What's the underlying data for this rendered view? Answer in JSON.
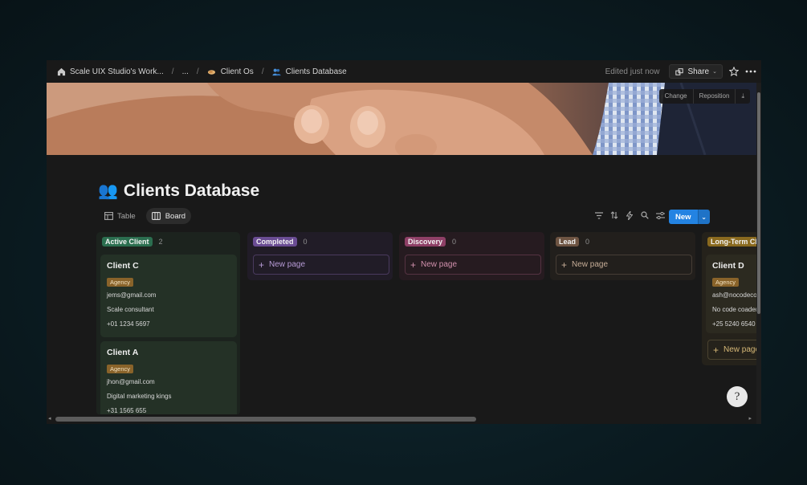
{
  "topbar": {
    "breadcrumbs": [
      {
        "icon": "home-icon",
        "label": "Scale UIX Studio's Work..."
      },
      {
        "icon": "",
        "label": "..."
      },
      {
        "icon": "handshake-icon",
        "label": "Client Os"
      },
      {
        "icon": "people-icon",
        "label": "Clients Database"
      }
    ],
    "edited": "Edited just now",
    "share_label": "Share"
  },
  "cover": {
    "change_label": "Change",
    "reposition_label": "Reposition"
  },
  "page": {
    "icon": "👥",
    "title": "Clients Database"
  },
  "views": [
    {
      "label": "Table",
      "icon": "table-icon",
      "active": false
    },
    {
      "label": "Board",
      "icon": "board-icon",
      "active": true
    }
  ],
  "toolbar": {
    "new_label": "New"
  },
  "board": {
    "columns": [
      {
        "name": "Active Client",
        "count": "2",
        "tag_color": "#2b6e4f",
        "bg": "#1c231e",
        "card_bg": "#243126",
        "cards": [
          {
            "name": "Client C",
            "badge": "Agency",
            "email": "jems@gmail.com",
            "company": "Scale consultant",
            "phone": "+01 1234 5697"
          },
          {
            "name": "Client A",
            "badge": "Agency",
            "email": "jhon@gmail.com",
            "company": "Digital marketing kings",
            "phone": "+31 1565 655"
          }
        ]
      },
      {
        "name": "Completed",
        "count": "0",
        "tag_color": "#6a4c93",
        "bg": "#211c27",
        "newpage": "New page"
      },
      {
        "name": "Discovery",
        "count": "0",
        "tag_color": "#8e3f66",
        "bg": "#261b20",
        "newpage": "New page"
      },
      {
        "name": "Lead",
        "count": "0",
        "tag_color": "#6e5442",
        "bg": "#221f1c",
        "newpage": "New page"
      },
      {
        "name": "Long-Term Cl",
        "count": "",
        "tag_color": "#8a6a1f",
        "bg": "#25221b",
        "card_bg": "#2c2a20",
        "newpage": "New page",
        "cards": [
          {
            "name": "Client D",
            "badge": "Agency",
            "email": "ash@nocodecoo",
            "company": "No code coader",
            "phone": "+25 5240 6540"
          }
        ]
      }
    ]
  },
  "help": {
    "label": "?"
  }
}
